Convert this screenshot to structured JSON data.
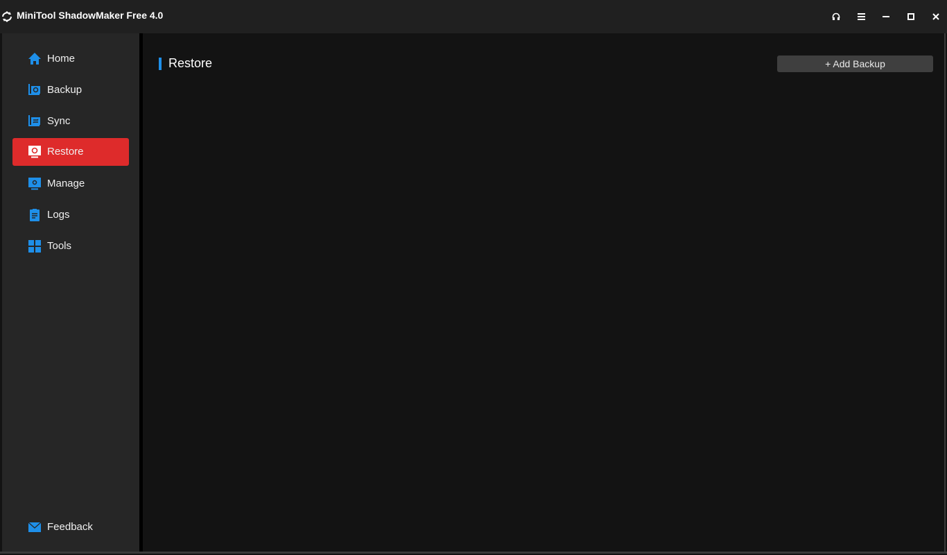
{
  "window": {
    "title": "MiniTool ShadowMaker Free 4.0",
    "controls": [
      {
        "name": "support-button",
        "icon": "headset-icon"
      },
      {
        "name": "menu-button",
        "icon": "hamburger-menu-icon"
      },
      {
        "name": "minimize-button",
        "icon": "minimize-icon"
      },
      {
        "name": "maximize-button",
        "icon": "maximize-icon"
      },
      {
        "name": "close-button",
        "icon": "close-icon"
      }
    ]
  },
  "sidebar": {
    "items": [
      {
        "label": "Home",
        "icon": "home-icon",
        "active": false
      },
      {
        "label": "Backup",
        "icon": "backup-icon",
        "active": false
      },
      {
        "label": "Sync",
        "icon": "sync-icon",
        "active": false
      },
      {
        "label": "Restore",
        "icon": "restore-icon",
        "active": true
      },
      {
        "label": "Manage",
        "icon": "manage-icon",
        "active": false
      },
      {
        "label": "Logs",
        "icon": "logs-icon",
        "active": false
      },
      {
        "label": "Tools",
        "icon": "tools-icon",
        "active": false
      }
    ],
    "feedback": {
      "label": "Feedback",
      "icon": "mail-icon"
    }
  },
  "main": {
    "section_title": "Restore",
    "add_backup_label": "+ Add Backup"
  },
  "colors": {
    "accent_blue": "#1e8fe9",
    "active_red": "#de2b2b"
  }
}
